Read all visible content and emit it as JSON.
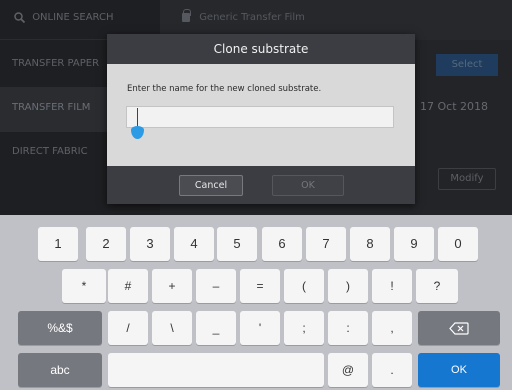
{
  "sidebar": {
    "search_label": "ONLINE SEARCH",
    "items": [
      {
        "label": "TRANSFER PAPER"
      },
      {
        "label": "TRANSFER FILM"
      },
      {
        "label": "DIRECT FABRIC"
      }
    ]
  },
  "main": {
    "substrate_name": "Generic Transfer Film",
    "select_label": "Select",
    "date": "17 Oct 2018",
    "modify_label": "Modify"
  },
  "dialog": {
    "title": "Clone substrate",
    "message": "Enter the name for the new cloned substrate.",
    "input_value": "",
    "cancel_label": "Cancel",
    "ok_label": "OK"
  },
  "keyboard": {
    "row1": [
      "1",
      "2",
      "3",
      "4",
      "5",
      "6",
      "7",
      "8",
      "9",
      "0"
    ],
    "row2": [
      "*",
      "#",
      "+",
      "–",
      "=",
      "(",
      ")",
      "!",
      "?"
    ],
    "row3": [
      "%&$",
      "/",
      "\\",
      "_",
      "'",
      ";",
      ":",
      ","
    ],
    "row4": [
      "abc",
      "",
      "@",
      ".",
      "OK"
    ],
    "backspace_icon": "backspace-icon",
    "colors": {
      "ok_key": "#1577cf",
      "function_key": "#75787e"
    }
  }
}
